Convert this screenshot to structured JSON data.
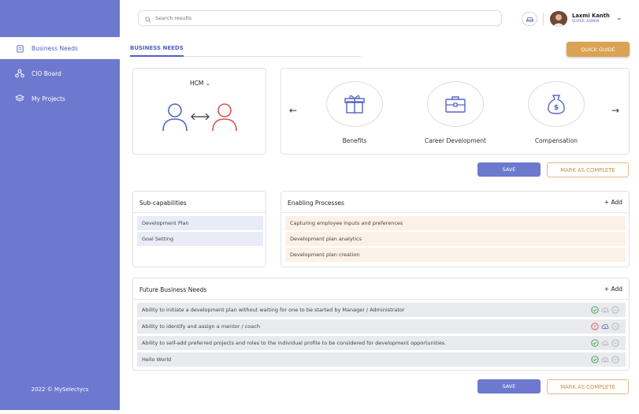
{
  "sidebar": {
    "items": [
      {
        "label": "Business Needs",
        "active": true
      },
      {
        "label": "CIO Board",
        "active": false
      },
      {
        "label": "My Projects",
        "active": false
      }
    ],
    "footer": "2022 © MySelectycs"
  },
  "header": {
    "search_placeholder": "Search results",
    "user_name": "Laxmi Kanth",
    "user_role": "SUPER ADMIN"
  },
  "tabs": {
    "active": "BUSINESS NEEDS"
  },
  "quick_guide_label": "QUICK GUIDE",
  "hcm": {
    "title": "HCM"
  },
  "categories": [
    {
      "label": "Benefits",
      "icon": "gift-icon"
    },
    {
      "label": "Career Development",
      "icon": "briefcase-icon"
    },
    {
      "label": "Compensation",
      "icon": "money-bag-icon"
    }
  ],
  "actions": {
    "save": "SAVE",
    "complete": "MARK AS COMPLETE"
  },
  "subcapabilities": {
    "title": "Sub-capabilities",
    "items": [
      "Development Plan",
      "Goal Setting"
    ]
  },
  "processes": {
    "title": "Enabling Processes",
    "add": "Add",
    "items": [
      "Capturing employee inputs and preferences",
      "Development plan analytics",
      "Development plan creation"
    ]
  },
  "future_needs": {
    "title": "Future Business Needs",
    "add": "Add",
    "items": [
      {
        "text": "Ability to initiate a development plan without waiting for one to be started by Manager / Administrator",
        "status": "ok"
      },
      {
        "text": "Ability to identify and assign a mentor / coach",
        "status": "alert"
      },
      {
        "text": "Ability to self-add preferred projects and roles to the individual profile to be considered for development opportunities.",
        "status": "ok"
      },
      {
        "text": "Hello World",
        "status": "ok"
      }
    ]
  },
  "colors": {
    "primary": "#6c79cf",
    "accent": "#d9a353",
    "ok": "#3aa04a",
    "alert": "#d9534f"
  }
}
